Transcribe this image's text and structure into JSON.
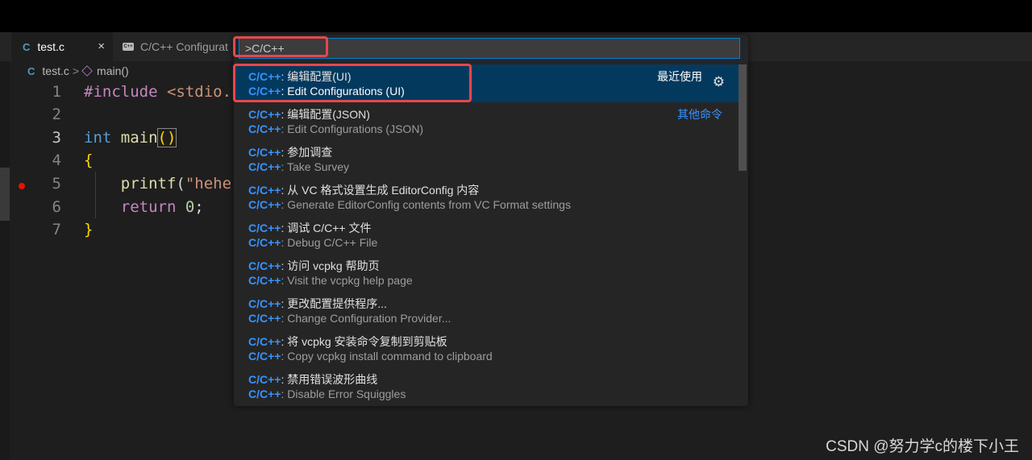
{
  "tabs": [
    {
      "icon": "C",
      "label": "test.c",
      "close": "×"
    },
    {
      "label": "C/C++ Configurat"
    }
  ],
  "breadcrumb": {
    "file_icon": "C",
    "file": "test.c",
    "separator": ">",
    "symbol": "main()"
  },
  "editor": {
    "lines": [
      "1",
      "2",
      "3",
      "4",
      "5",
      "6",
      "7"
    ],
    "code": {
      "l1_pp": "#include",
      "l1_hdr": " <stdio.",
      "l3_kw": "int",
      "l3_fn": " main",
      "l3_paren": "()",
      "l4": "{",
      "l5_fn": "    printf",
      "l5_paren": "(",
      "l5_str": "\"hehe",
      "l6_kw": "    return",
      "l6_num": " 0",
      "l6_semi": ";",
      "l7": "}"
    }
  },
  "palette": {
    "input_value": ">C/C++",
    "items": [
      {
        "cat": "C/C++",
        "zh": ": 编辑配置(UI)",
        "en": ": Edit Configurations (UI)",
        "tag": "最近使用",
        "gear": "⚙"
      },
      {
        "cat": "C/C++",
        "zh": ": 编辑配置(JSON)",
        "en": ": Edit Configurations (JSON)",
        "tag": "其他命令"
      },
      {
        "cat": "C/C++",
        "zh": ": 参加调查",
        "en": ": Take Survey"
      },
      {
        "cat": "C/C++",
        "zh": ": 从 VC 格式设置生成 EditorConfig 内容",
        "en": ": Generate EditorConfig contents from VC Format settings"
      },
      {
        "cat": "C/C++",
        "zh": ": 调试 C/C++ 文件",
        "en": ": Debug C/C++ File"
      },
      {
        "cat": "C/C++",
        "zh": ": 访问 vcpkg 帮助页",
        "en": ": Visit the vcpkg help page"
      },
      {
        "cat": "C/C++",
        "zh": ": 更改配置提供程序...",
        "en": ": Change Configuration Provider..."
      },
      {
        "cat": "C/C++",
        "zh": ": 将 vcpkg 安装命令复制到剪贴板",
        "en": ": Copy vcpkg install command to clipboard"
      },
      {
        "cat": "C/C++",
        "zh": ": 禁用错误波形曲线",
        "en": ": Disable Error Squiggles"
      }
    ]
  },
  "watermark": "CSDN @努力学c的楼下小王",
  "colors": {
    "accent": "#3794ff",
    "selection": "#04395e",
    "highlight_box": "#e5484d"
  }
}
